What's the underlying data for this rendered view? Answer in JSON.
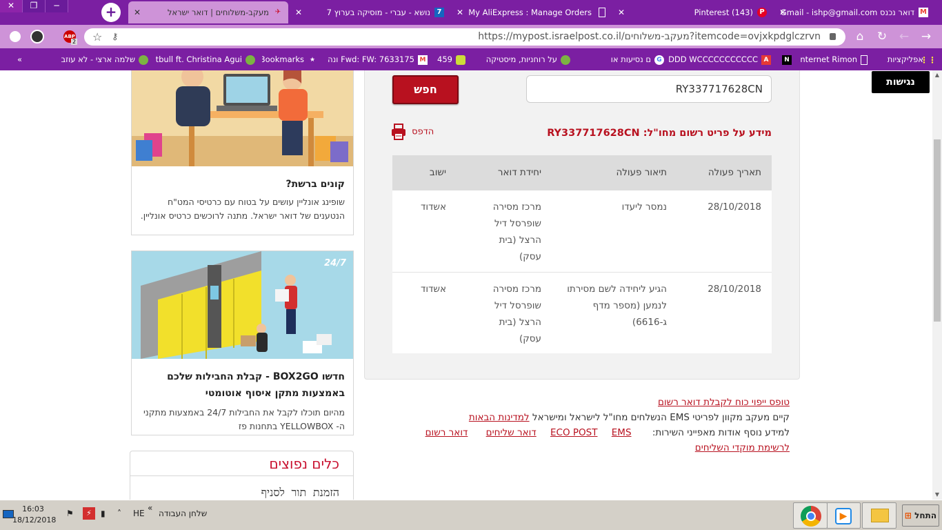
{
  "browser": {
    "tabs": [
      {
        "title": "מעקב-משלוחים | דואר ישראל",
        "icon": "israel-post-icon"
      },
      {
        "title": "נושא - עברי - מוסיקה בערוץ 7",
        "icon": "channel7-icon",
        "icon_text": "7"
      },
      {
        "title": "My AliExpress : Manage Orders",
        "icon": "page-icon"
      },
      {
        "title": "(143) Pinterest",
        "icon": "pinterest-icon"
      },
      {
        "title": "דואר נכנס Gmail - ishp@gmail.com",
        "icon": "gmail-icon"
      }
    ],
    "url": "https://mypost.israelpost.co.il/מעקב-משלוחים?itemcode=ovjxkpdglczrvn",
    "abp_count": "2",
    "abp_label": "ABP",
    "bookmarks": [
      {
        "label": "אפליקציות",
        "icon": "apps-icon"
      },
      {
        "label": "Internet Rimon",
        "icon": "page-icon"
      },
      {
        "label": "",
        "icon": "n-icon",
        "icon_text": "N"
      },
      {
        "label": "DDD WCCCCCCCCCCC",
        "icon": "adobe-icon"
      },
      {
        "label": "ם נסיעות או",
        "icon": "google-icon",
        "icon_text": "G"
      },
      {
        "label": "על רוחניות, מיסטיקה",
        "icon": "green-circle-icon"
      },
      {
        "label": "459",
        "icon": "gold-icon"
      },
      {
        "label": "Fwd: FW: 7633175 ונה",
        "icon": "gmail-icon"
      },
      {
        "label": "Bookmarks",
        "icon": "star-icon"
      },
      {
        "label": "Pitbull ft. Christina Agui",
        "icon": "green-circle-icon"
      },
      {
        "label": "שלמה ארצי - לא עוזב",
        "icon": "green-circle-icon"
      }
    ],
    "bookmarks_more": "»"
  },
  "page": {
    "accessibility_label": "נגישות",
    "search": {
      "value": "RY337717628CN",
      "button_label": "חפש"
    },
    "info_title": "מידע על פריט רשום מחו\"ל: RY337717628CN",
    "print_label": "הדפס",
    "table": {
      "headers": [
        "תאריך פעולה",
        "תיאור פעולה",
        "יחידת דואר",
        "ישוב"
      ],
      "rows": [
        [
          "28/10/2018",
          "נמסר ליעדו",
          "מרכז מסירה שופרסל דיל הרצל (בית עסק)",
          "אשדוד"
        ],
        [
          "28/10/2018",
          "הגיע ליחידה לשם מסירתו לנמען (מספר מדף ג-6616)",
          "מרכז מסירה שופרסל דיל הרצל (בית עסק)",
          "אשדוד"
        ]
      ]
    },
    "links": {
      "proxy_form": "טופס ייפוי כוח לקבלת דואר רשום",
      "ems_text": "קיים מעקב מקוון לפריטי EMS הנשלחים מחו\"ל לישראל ומישראל",
      "countries_link": "למדינות הבאות",
      "services_text": "למידע נוסף אודות מאפייני השירות:",
      "services": [
        "EMS",
        "ECO POST",
        "דואר שליחים",
        "דואר רשום"
      ],
      "courier_centers": "לרשימת מוקדי השליחים"
    },
    "cards": [
      {
        "title": "קונים ברשת?",
        "text": "שופינג אונליין עושים על בטוח עם כרטיסי המט\"ח הנטענים של דואר ישראל. מתנה לרוכשים כרטיס אונליין."
      },
      {
        "title": "חדשו BOX2GO - קבלת החבילות שלכם באמצעות מתקן איסוף אוטומטי",
        "text": "מהיום תוכלו לקבל את החבילות 24/7 באמצעות מתקני ה- YELLOWBOX בתחנות פז",
        "badge": "24/7"
      }
    ],
    "tools": {
      "title": "כלים נפוצים",
      "item": "הזמנת תור לסניף"
    }
  },
  "taskbar": {
    "start_label": "התחל",
    "desktop_label": "שלחן העבודה",
    "lang": "HE",
    "time": "16:03",
    "date": "18/12/2018"
  },
  "colors": {
    "brand_red": "#b8111f",
    "chrome_purple": "#7b1fa2",
    "chrome_light": "#ce93d8"
  }
}
